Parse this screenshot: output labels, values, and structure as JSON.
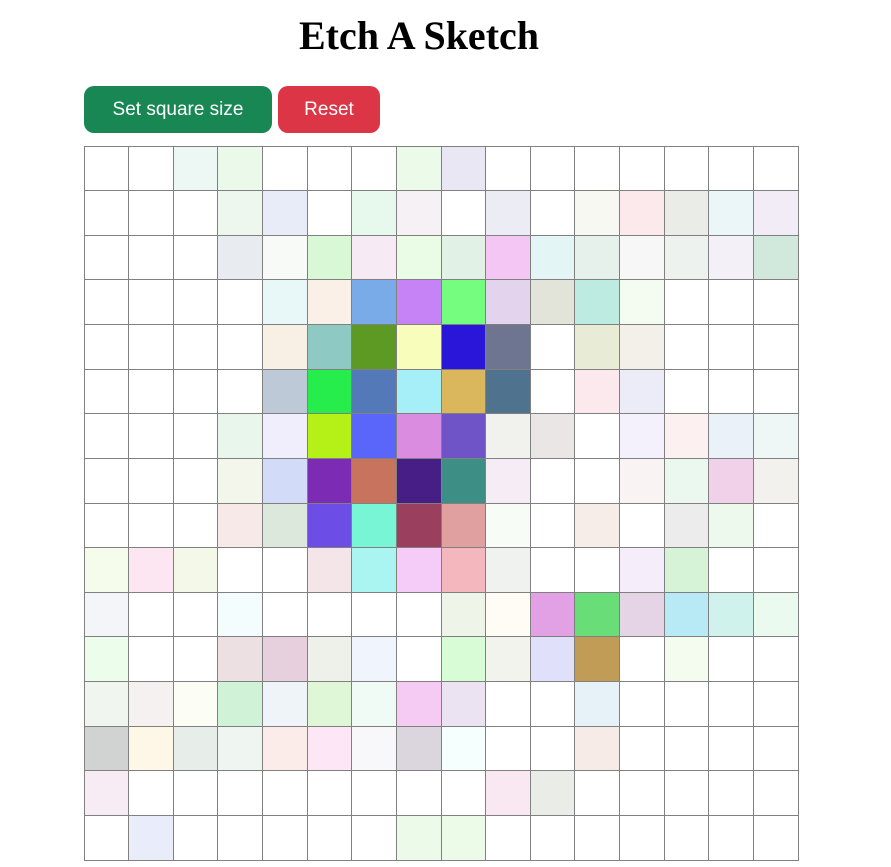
{
  "header": {
    "title": "Etch A Sketch"
  },
  "controls": {
    "set_size_label": "Set square size",
    "set_size_color": "#198754",
    "reset_label": "Reset",
    "reset_color": "#dc3545"
  },
  "grid": {
    "size": 16,
    "border_color": "#808080",
    "cells": [
      [
        "#ffffff",
        "#ffffff",
        "#edf7f3",
        "#eaf9ea",
        "#ffffff",
        "#ffffff",
        "#ffffff",
        "#ecfbe9",
        "#e9e7f4",
        "#ffffff",
        "#ffffff",
        "#ffffff",
        "#ffffff",
        "#ffffff",
        "#ffffff",
        "#ffffff"
      ],
      [
        "#ffffff",
        "#ffffff",
        "#ffffff",
        "#eef7ee",
        "#e8ecf8",
        "#ffffff",
        "#e6f9ec",
        "#f6f1f5",
        "#ffffff",
        "#ececf4",
        "#ffffff",
        "#f8f8f3",
        "#fbe9ec",
        "#eaece8",
        "#eaf6f7",
        "#f2ecf6"
      ],
      [
        "#ffffff",
        "#ffffff",
        "#ffffff",
        "#e8ebef",
        "#f7faf7",
        "#d9f8d6",
        "#f6eaf5",
        "#ebfce6",
        "#e1f1e6",
        "#f3c6f4",
        "#e3f6f5",
        "#e7f1ec",
        "#f7f7f7",
        "#eef2ee",
        "#f3f0f7",
        "#d0e9dc"
      ],
      [
        "#ffffff",
        "#ffffff",
        "#ffffff",
        "#ffffff",
        "#e8f7f8",
        "#faf0e7",
        "#78abe8",
        "#c583f6",
        "#75fd80",
        "#e3d3ec",
        "#e3e4d9",
        "#bdebe1",
        "#f4fbf1",
        "#ffffff",
        "#ffffff",
        "#ffffff"
      ],
      [
        "#ffffff",
        "#ffffff",
        "#ffffff",
        "#ffffff",
        "#f8efe5",
        "#8ec9c4",
        "#5c9a24",
        "#f9fdbb",
        "#2a16d8",
        "#6d7590",
        "#ffffff",
        "#e8ecd6",
        "#f3f0ea",
        "#ffffff",
        "#ffffff",
        "#ffffff"
      ],
      [
        "#ffffff",
        "#ffffff",
        "#ffffff",
        "#ffffff",
        "#bdc9d6",
        "#26ec4c",
        "#5379b8",
        "#a6eef8",
        "#dab75c",
        "#4f728f",
        "#ffffff",
        "#fbe9ed",
        "#ecebf8",
        "#ffffff",
        "#ffffff",
        "#ffffff"
      ],
      [
        "#ffffff",
        "#ffffff",
        "#ffffff",
        "#e8f6ec",
        "#f0eefc",
        "#b5f116",
        "#5a65f9",
        "#da8ce0",
        "#6e54c6",
        "#f1f1ee",
        "#eae6e6",
        "#ffffff",
        "#f5f1fc",
        "#fdf0f1",
        "#eaf1f9",
        "#eff6f6"
      ],
      [
        "#ffffff",
        "#ffffff",
        "#ffffff",
        "#f3f6ea",
        "#d2dcf8",
        "#7c2bb4",
        "#c8735e",
        "#461e85",
        "#3d8e84",
        "#f6ecf5",
        "#ffffff",
        "#ffffff",
        "#f9f3f4",
        "#ebf8f0",
        "#f1d1ea",
        "#f2f1ee"
      ],
      [
        "#ffffff",
        "#ffffff",
        "#ffffff",
        "#f8e9e9",
        "#dce8dc",
        "#6c4ee6",
        "#78f5d5",
        "#9b3f5f",
        "#e0a09f",
        "#f7fcf7",
        "#ffffff",
        "#f6ece8",
        "#ffffff",
        "#ececec",
        "#eef9ee",
        "#ffffff"
      ],
      [
        "#f5fceb",
        "#fbe6f2",
        "#f3f8e8",
        "#ffffff",
        "#ffffff",
        "#f4e5e8",
        "#aaf4f2",
        "#f4ccf7",
        "#f3b7bd",
        "#f0f2f0",
        "#ffffff",
        "#ffffff",
        "#f5edf9",
        "#d6f3d8",
        "#ffffff",
        "#ffffff"
      ],
      [
        "#f3f5f9",
        "#ffffff",
        "#ffffff",
        "#f4fdfd",
        "#ffffff",
        "#ffffff",
        "#ffffff",
        "#ffffff",
        "#eef5e8",
        "#fefcf5",
        "#e2a1e4",
        "#68dd78",
        "#e4d4e6",
        "#b8eaf5",
        "#cff2ec",
        "#eafaee"
      ],
      [
        "#ecfdec",
        "#ffffff",
        "#ffffff",
        "#ede0e3",
        "#e7d0de",
        "#eef0ea",
        "#f0f4fd",
        "#ffffff",
        "#d7fcd6",
        "#f3f3ed",
        "#e0e0fb",
        "#c09c57",
        "#ffffff",
        "#f4fbef",
        "#ffffff",
        "#ffffff"
      ],
      [
        "#f0f6ef",
        "#f6f1f1",
        "#fcfdf4",
        "#d0f3d8",
        "#eef4f8",
        "#dff6d7",
        "#f1fbf5",
        "#f5caf3",
        "#ebe3f2",
        "#ffffff",
        "#ffffff",
        "#e6f1f8",
        "#ffffff",
        "#ffffff",
        "#ffffff",
        "#ffffff"
      ],
      [
        "#d1d3d2",
        "#fdf7e8",
        "#e7ede9",
        "#eff6f2",
        "#fbece9",
        "#fde7f6",
        "#f8f7fa",
        "#dbd5de",
        "#f4fffe",
        "#ffffff",
        "#ffffff",
        "#f6ebe6",
        "#ffffff",
        "#ffffff",
        "#ffffff",
        "#ffffff"
      ],
      [
        "#f7ecf3",
        "#ffffff",
        "#ffffff",
        "#ffffff",
        "#ffffff",
        "#ffffff",
        "#ffffff",
        "#ffffff",
        "#ffffff",
        "#f9e7f2",
        "#e9ece7",
        "#ffffff",
        "#ffffff",
        "#ffffff",
        "#ffffff",
        "#ffffff"
      ],
      [
        "#ffffff",
        "#e8edf9",
        "#ffffff",
        "#ffffff",
        "#ffffff",
        "#ffffff",
        "#ffffff",
        "#ecfaea",
        "#ecfbe7",
        "#ffffff",
        "#ffffff",
        "#ffffff",
        "#ffffff",
        "#ffffff",
        "#ffffff",
        "#ffffff"
      ]
    ]
  }
}
